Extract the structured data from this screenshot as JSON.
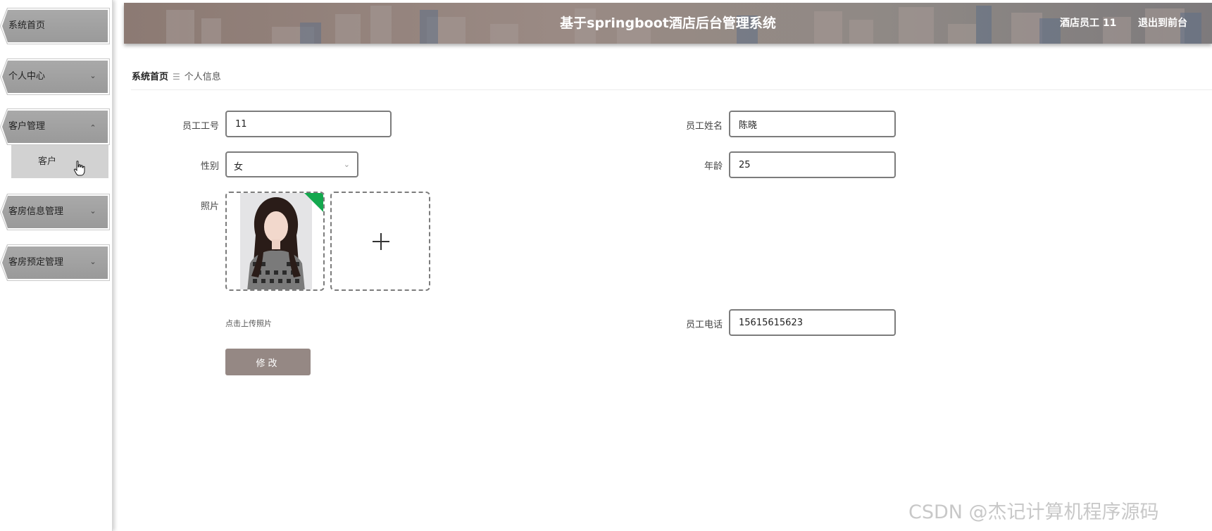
{
  "sidebar": {
    "items": [
      {
        "label": "系统首页"
      },
      {
        "label": "个人中心"
      },
      {
        "label": "客户管理"
      },
      {
        "label": "客房信息管理"
      },
      {
        "label": "客房预定管理"
      }
    ],
    "subitems": [
      {
        "label": "客户"
      }
    ]
  },
  "header": {
    "title": "基于springboot酒店后台管理系统",
    "user": "酒店员工 11",
    "back_link": "退出到前台"
  },
  "breadcrumb": {
    "home": "系统首页",
    "separator": "☰",
    "current": "个人信息"
  },
  "form": {
    "employee_no_label": "员工工号",
    "employee_no_value": "11",
    "employee_name_label": "员工姓名",
    "employee_name_value": "陈晓",
    "gender_label": "性别",
    "gender_value": "女",
    "age_label": "年龄",
    "age_value": "25",
    "photo_label": "照片",
    "upload_tip": "点击上传照片",
    "phone_label": "员工电话",
    "phone_value": "15615615623",
    "submit_label": "修改"
  },
  "watermark": "CSDN @杰记计算机程序源码",
  "colors": {
    "accent": "#958884",
    "upload_success": "#13a84e"
  }
}
